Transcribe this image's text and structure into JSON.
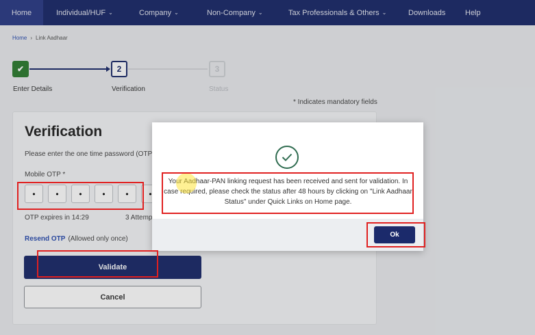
{
  "nav": {
    "items": [
      {
        "label": "Home",
        "caret": ""
      },
      {
        "label": "Individual/HUF",
        "caret": "⌄"
      },
      {
        "label": "Company",
        "caret": "⌄"
      },
      {
        "label": "Non-Company",
        "caret": "⌄"
      },
      {
        "label": "Tax Professionals & Others",
        "caret": "⌄"
      },
      {
        "label": "Downloads",
        "caret": ""
      },
      {
        "label": "Help",
        "caret": ""
      }
    ]
  },
  "breadcrumb": {
    "home": "Home",
    "separator": "›",
    "current": "Link Aadhaar"
  },
  "stepper": {
    "steps": [
      {
        "marker": "✔",
        "label": "Enter Details",
        "state": "completed"
      },
      {
        "marker": "2",
        "label": "Verification",
        "state": "active"
      },
      {
        "marker": "3",
        "label": "Status",
        "state": "pending"
      }
    ]
  },
  "mandatory_note": "* Indicates mandatory fields",
  "verification": {
    "title": "Verification",
    "description": "Please enter the one time password (OTP)",
    "otp_label": "Mobile OTP *",
    "otp_digits": [
      "•",
      "•",
      "•",
      "•",
      "•",
      "•"
    ],
    "otp_expiry": "OTP expires in 14:29",
    "attempts": "3 Attemp",
    "resend_link": "Resend OTP",
    "resend_note": "(Allowed only once)",
    "validate_label": "Validate",
    "cancel_label": "Cancel"
  },
  "modal": {
    "icon": "check-circle-icon",
    "message": "Your Aadhaar-PAN linking request has been received and sent for validation. In case required, please check the status after 48 hours by clicking on \"Link Aadhaar Status\" under Quick Links on Home page.",
    "ok_label": "Ok"
  },
  "colors": {
    "brand": "#1b2a6b",
    "success": "#2e7d32",
    "highlight": "#e02020"
  }
}
